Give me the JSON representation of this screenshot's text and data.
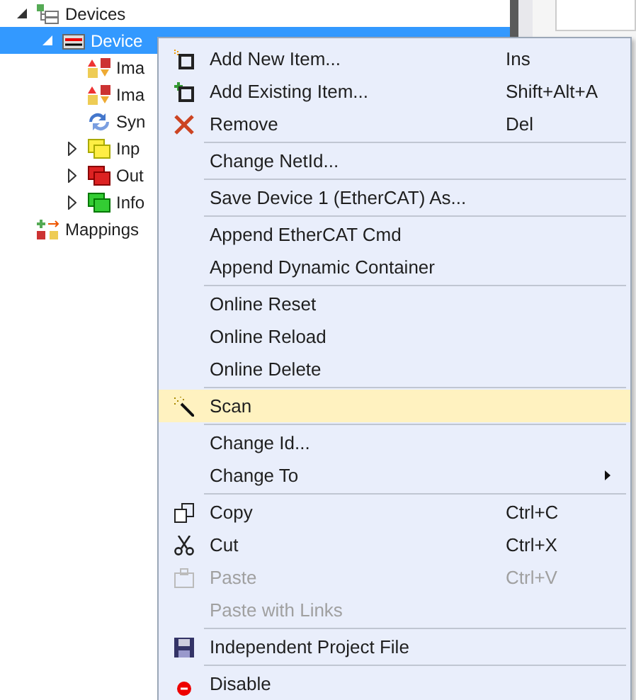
{
  "tree": [
    {
      "label": "Devices",
      "expanded": true,
      "selected": false,
      "kind": "devices",
      "children": [
        {
          "label": "Device",
          "expanded": true,
          "selected": true,
          "kind": "device",
          "children": [
            {
              "label": "Ima",
              "kind": "image",
              "selected": false
            },
            {
              "label": "Ima",
              "kind": "image",
              "selected": false
            },
            {
              "label": "Syn",
              "kind": "sync",
              "selected": false
            },
            {
              "label": "Inp",
              "kind": "yellow",
              "expanded": false,
              "selected": false
            },
            {
              "label": "Out",
              "kind": "red",
              "expanded": false,
              "selected": false
            },
            {
              "label": "Info",
              "kind": "green",
              "expanded": false,
              "selected": false
            }
          ]
        }
      ]
    },
    {
      "label": "Mappings",
      "kind": "mappings",
      "selected": false
    }
  ],
  "context_menu": {
    "groups": [
      [
        {
          "label": "Add New Item...",
          "shortcut": "Ins",
          "kind": "new",
          "disabled": false,
          "selected": false
        },
        {
          "label": "Add Existing Item...",
          "shortcut": "Shift+Alt+A",
          "kind": "existing",
          "disabled": false,
          "selected": false
        },
        {
          "label": "Remove",
          "shortcut": "Del",
          "kind": "remove",
          "disabled": false,
          "selected": false
        }
      ],
      [
        {
          "label": "Change NetId...",
          "disabled": false,
          "selected": false
        }
      ],
      [
        {
          "label": "Save Device 1 (EtherCAT) As...",
          "disabled": false,
          "selected": false
        }
      ],
      [
        {
          "label": "Append EtherCAT Cmd",
          "disabled": false,
          "selected": false
        },
        {
          "label": "Append Dynamic Container",
          "disabled": false,
          "selected": false
        }
      ],
      [
        {
          "label": "Online Reset",
          "disabled": false,
          "selected": false
        },
        {
          "label": "Online Reload",
          "disabled": false,
          "selected": false
        },
        {
          "label": "Online Delete",
          "disabled": false,
          "selected": false
        }
      ],
      [
        {
          "label": "Scan",
          "kind": "wand",
          "disabled": false,
          "selected": true
        }
      ],
      [
        {
          "label": "Change Id...",
          "disabled": false,
          "selected": false
        },
        {
          "label": "Change To",
          "submenu": true,
          "disabled": false,
          "selected": false
        }
      ],
      [
        {
          "label": "Copy",
          "shortcut": "Ctrl+C",
          "kind": "copy",
          "disabled": false,
          "selected": false
        },
        {
          "label": "Cut",
          "shortcut": "Ctrl+X",
          "kind": "cut",
          "disabled": false,
          "selected": false
        },
        {
          "label": "Paste",
          "shortcut": "Ctrl+V",
          "kind": "paste",
          "disabled": true,
          "selected": false
        },
        {
          "label": "Paste with Links",
          "disabled": true,
          "selected": false
        }
      ],
      [
        {
          "label": "Independent Project File",
          "kind": "save",
          "disabled": false,
          "selected": false
        }
      ],
      [
        {
          "label": "Disable",
          "kind": "disable",
          "disabled": false,
          "selected": false
        }
      ]
    ]
  }
}
